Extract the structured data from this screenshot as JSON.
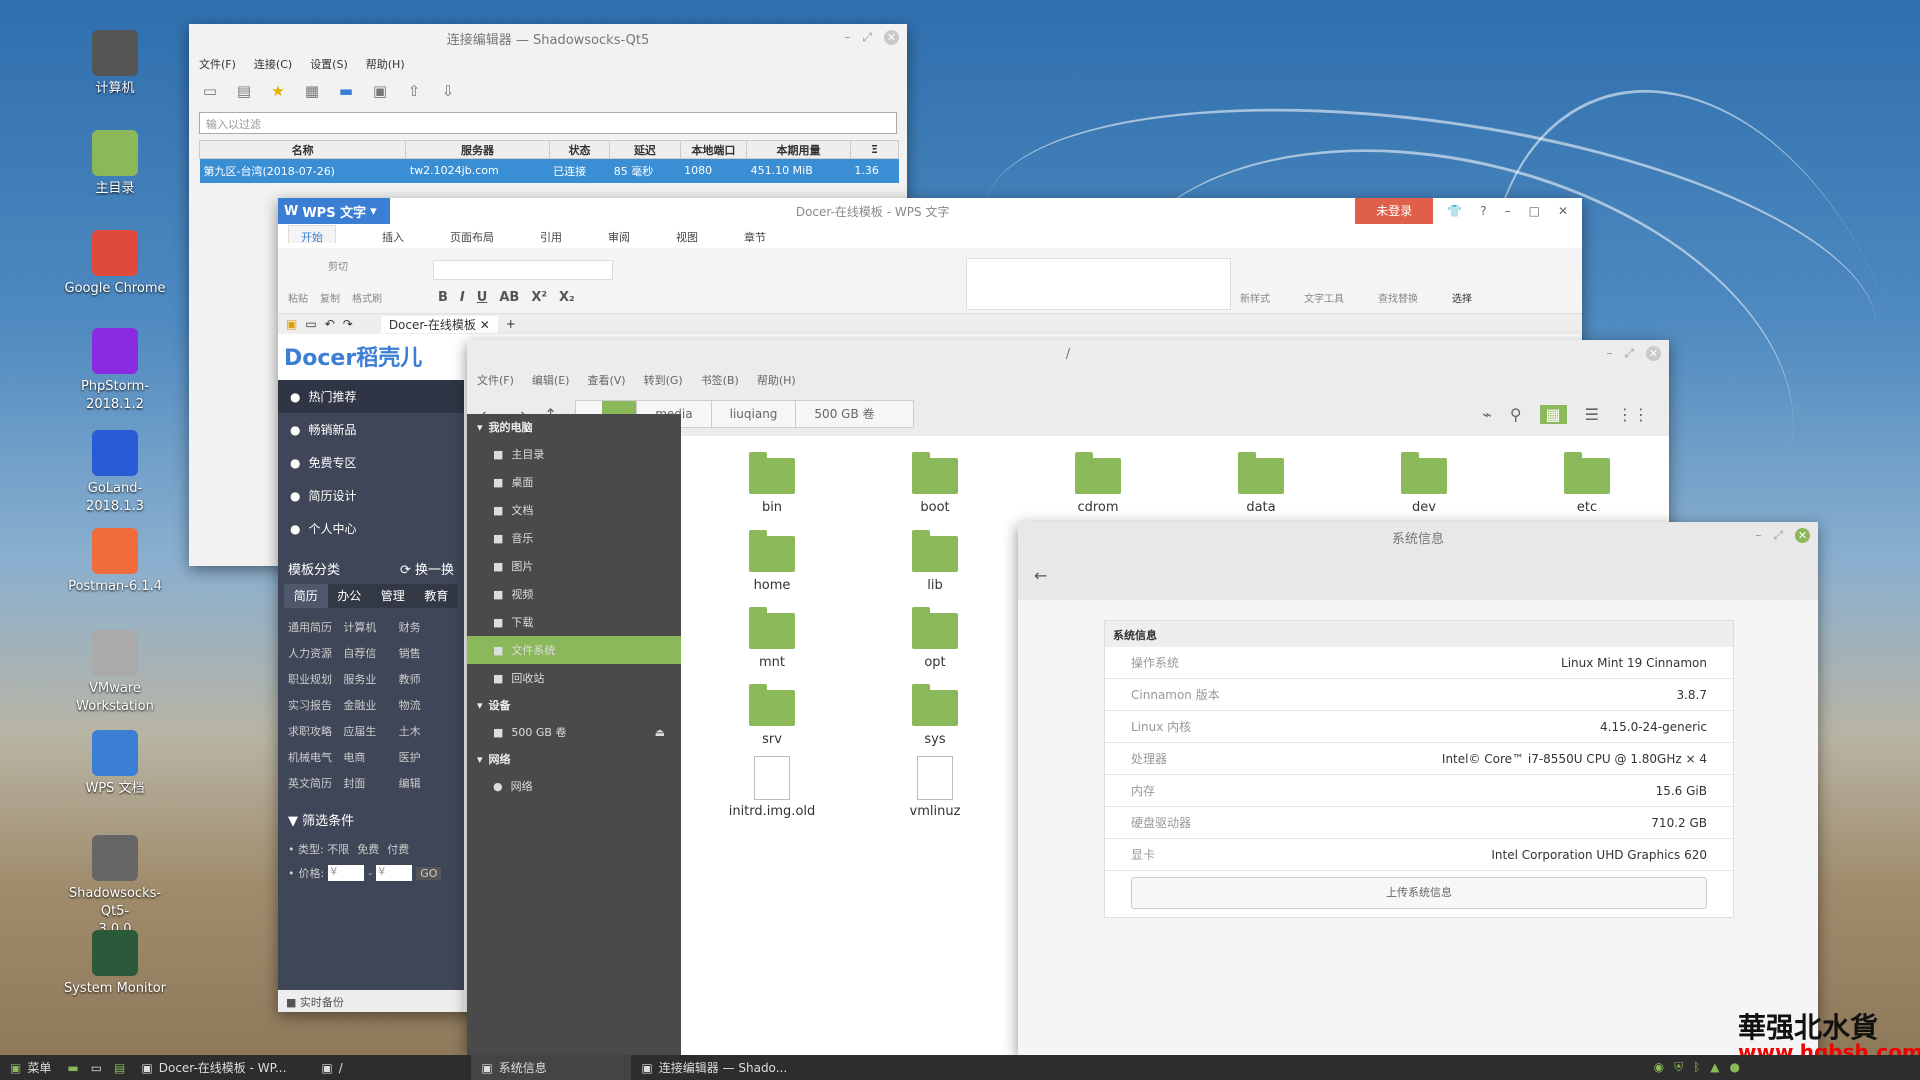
{
  "desktop": {
    "icons": [
      {
        "label": "计算机",
        "icon": "computer-icon",
        "color": "#555"
      },
      {
        "label": "主目录",
        "icon": "home-folder-icon",
        "color": "#8ab85b"
      },
      {
        "label": "Google Chrome",
        "icon": "chrome-icon",
        "color": "#e04a3c"
      },
      {
        "label": "PhpStorm-\n2018.1.2",
        "icon": "phpstorm-icon",
        "color": "#8a2be2"
      },
      {
        "label": "GoLand-2018.1.3",
        "icon": "goland-icon",
        "color": "#2a5bd7"
      },
      {
        "label": "Postman-6.1.4",
        "icon": "postman-icon",
        "color": "#f26b3a"
      },
      {
        "label": "VMware\nWorkstation",
        "icon": "vmware-icon",
        "color": "#aaa"
      },
      {
        "label": "WPS 文档",
        "icon": "wps-icon",
        "color": "#3b7fd5"
      },
      {
        "label": "Shadowsocks-Qt5-\n3.0.0",
        "icon": "shadowsocks-icon",
        "color": "#666"
      },
      {
        "label": "System Monitor",
        "icon": "system-monitor-icon",
        "color": "#2b5a3a"
      }
    ]
  },
  "ss": {
    "title": "连接编辑器 — Shadowsocks-Qt5",
    "menu": [
      "文件(F)",
      "连接(C)",
      "设置(S)",
      "帮助(H)"
    ],
    "filter_placeholder": "输入以过滤",
    "columns": [
      "名称",
      "服务器",
      "状态",
      "延迟",
      "本地端口",
      "本期用量",
      "Ξ"
    ],
    "row": [
      "第九区-台湾(2018-07-26)",
      "tw2.1024jb.com",
      "已连接",
      "85 毫秒",
      "1080",
      "451.10  MiB",
      "1.36"
    ]
  },
  "wps": {
    "app": "WPS 文字",
    "title": "Docer-在线模板 - WPS 文字",
    "login": "未登录",
    "tabs": [
      "开始",
      "插入",
      "页面布局",
      "引用",
      "审阅",
      "视图",
      "章节"
    ],
    "ribbon": {
      "paste": "粘贴",
      "cut": "剪切",
      "copy": "复制",
      "format": "格式刷",
      "newstyle": "新样式",
      "texttool": "文字工具",
      "findreplace": "查找替换",
      "select": "选择"
    },
    "doc_tab": "Docer-在线模板",
    "docer": {
      "logo": "Docer稻壳儿",
      "nav": [
        "热门推荐",
        "畅销新品",
        "免费专区",
        "简历设计",
        "个人中心"
      ],
      "cat_title": "模板分类",
      "switch": "换一换",
      "cat_tabs": [
        "简历",
        "办公",
        "管理",
        "教育"
      ],
      "cats": [
        [
          "通用简历",
          "计算机",
          "财务"
        ],
        [
          "人力资源",
          "自荐信",
          "销售"
        ],
        [
          "职业规划",
          "服务业",
          "教师"
        ],
        [
          "实习报告",
          "金融业",
          "物流"
        ],
        [
          "求职攻略",
          "应届生",
          "土木"
        ],
        [
          "机械电气",
          "电商",
          "医护"
        ],
        [
          "英文简历",
          "封面",
          "编辑"
        ]
      ],
      "filter_title": "筛选条件",
      "type_label": "类型:",
      "type_opts": [
        "不限",
        "免费",
        "付费"
      ],
      "price_label": "价格:",
      "price_ph": "¥",
      "go": "GO",
      "backup": "实时备份"
    }
  },
  "fm": {
    "title": "/",
    "menu": [
      "文件(F)",
      "编辑(E)",
      "查看(V)",
      "转到(G)",
      "书签(B)",
      "帮助(H)"
    ],
    "crumbs": [
      "media",
      "liuqiang",
      "500 GB 卷"
    ],
    "sidebar": {
      "my_pc": "我的电脑",
      "places": [
        "主目录",
        "桌面",
        "文档",
        "音乐",
        "图片",
        "视频",
        "下载",
        "文件系统",
        "回收站"
      ],
      "devices": "设备",
      "vol": "500 GB 卷",
      "network": "网络",
      "net_item": "网络"
    },
    "folders": [
      "bin",
      "boot",
      "cdrom",
      "data",
      "dev",
      "etc",
      "home",
      "lib",
      "mnt",
      "opt",
      "srv",
      "sys"
    ],
    "files": [
      "initrd.img.old",
      "vmlinuz"
    ]
  },
  "sysinfo": {
    "title": "系统信息",
    "header": "系统信息",
    "rows": [
      [
        "操作系统",
        "Linux Mint 19 Cinnamon"
      ],
      [
        "Cinnamon 版本",
        "3.8.7"
      ],
      [
        "Linux 内核",
        "4.15.0-24-generic"
      ],
      [
        "处理器",
        "Intel© Core™ i7-8550U CPU @ 1.80GHz × 4"
      ],
      [
        "内存",
        "15.6 GiB"
      ],
      [
        "硬盘驱动器",
        "710.2 GB"
      ],
      [
        "显卡",
        "Intel Corporation UHD Graphics 620"
      ]
    ],
    "upload": "上传系统信息"
  },
  "taskbar": {
    "menu": "菜单",
    "items": [
      "Docer-在线模板 - WP...",
      "/",
      "系统信息",
      "连接编辑器 — Shado..."
    ]
  },
  "watermark": {
    "text": "華强北水貨",
    "url": "www.hqbsh.com"
  }
}
